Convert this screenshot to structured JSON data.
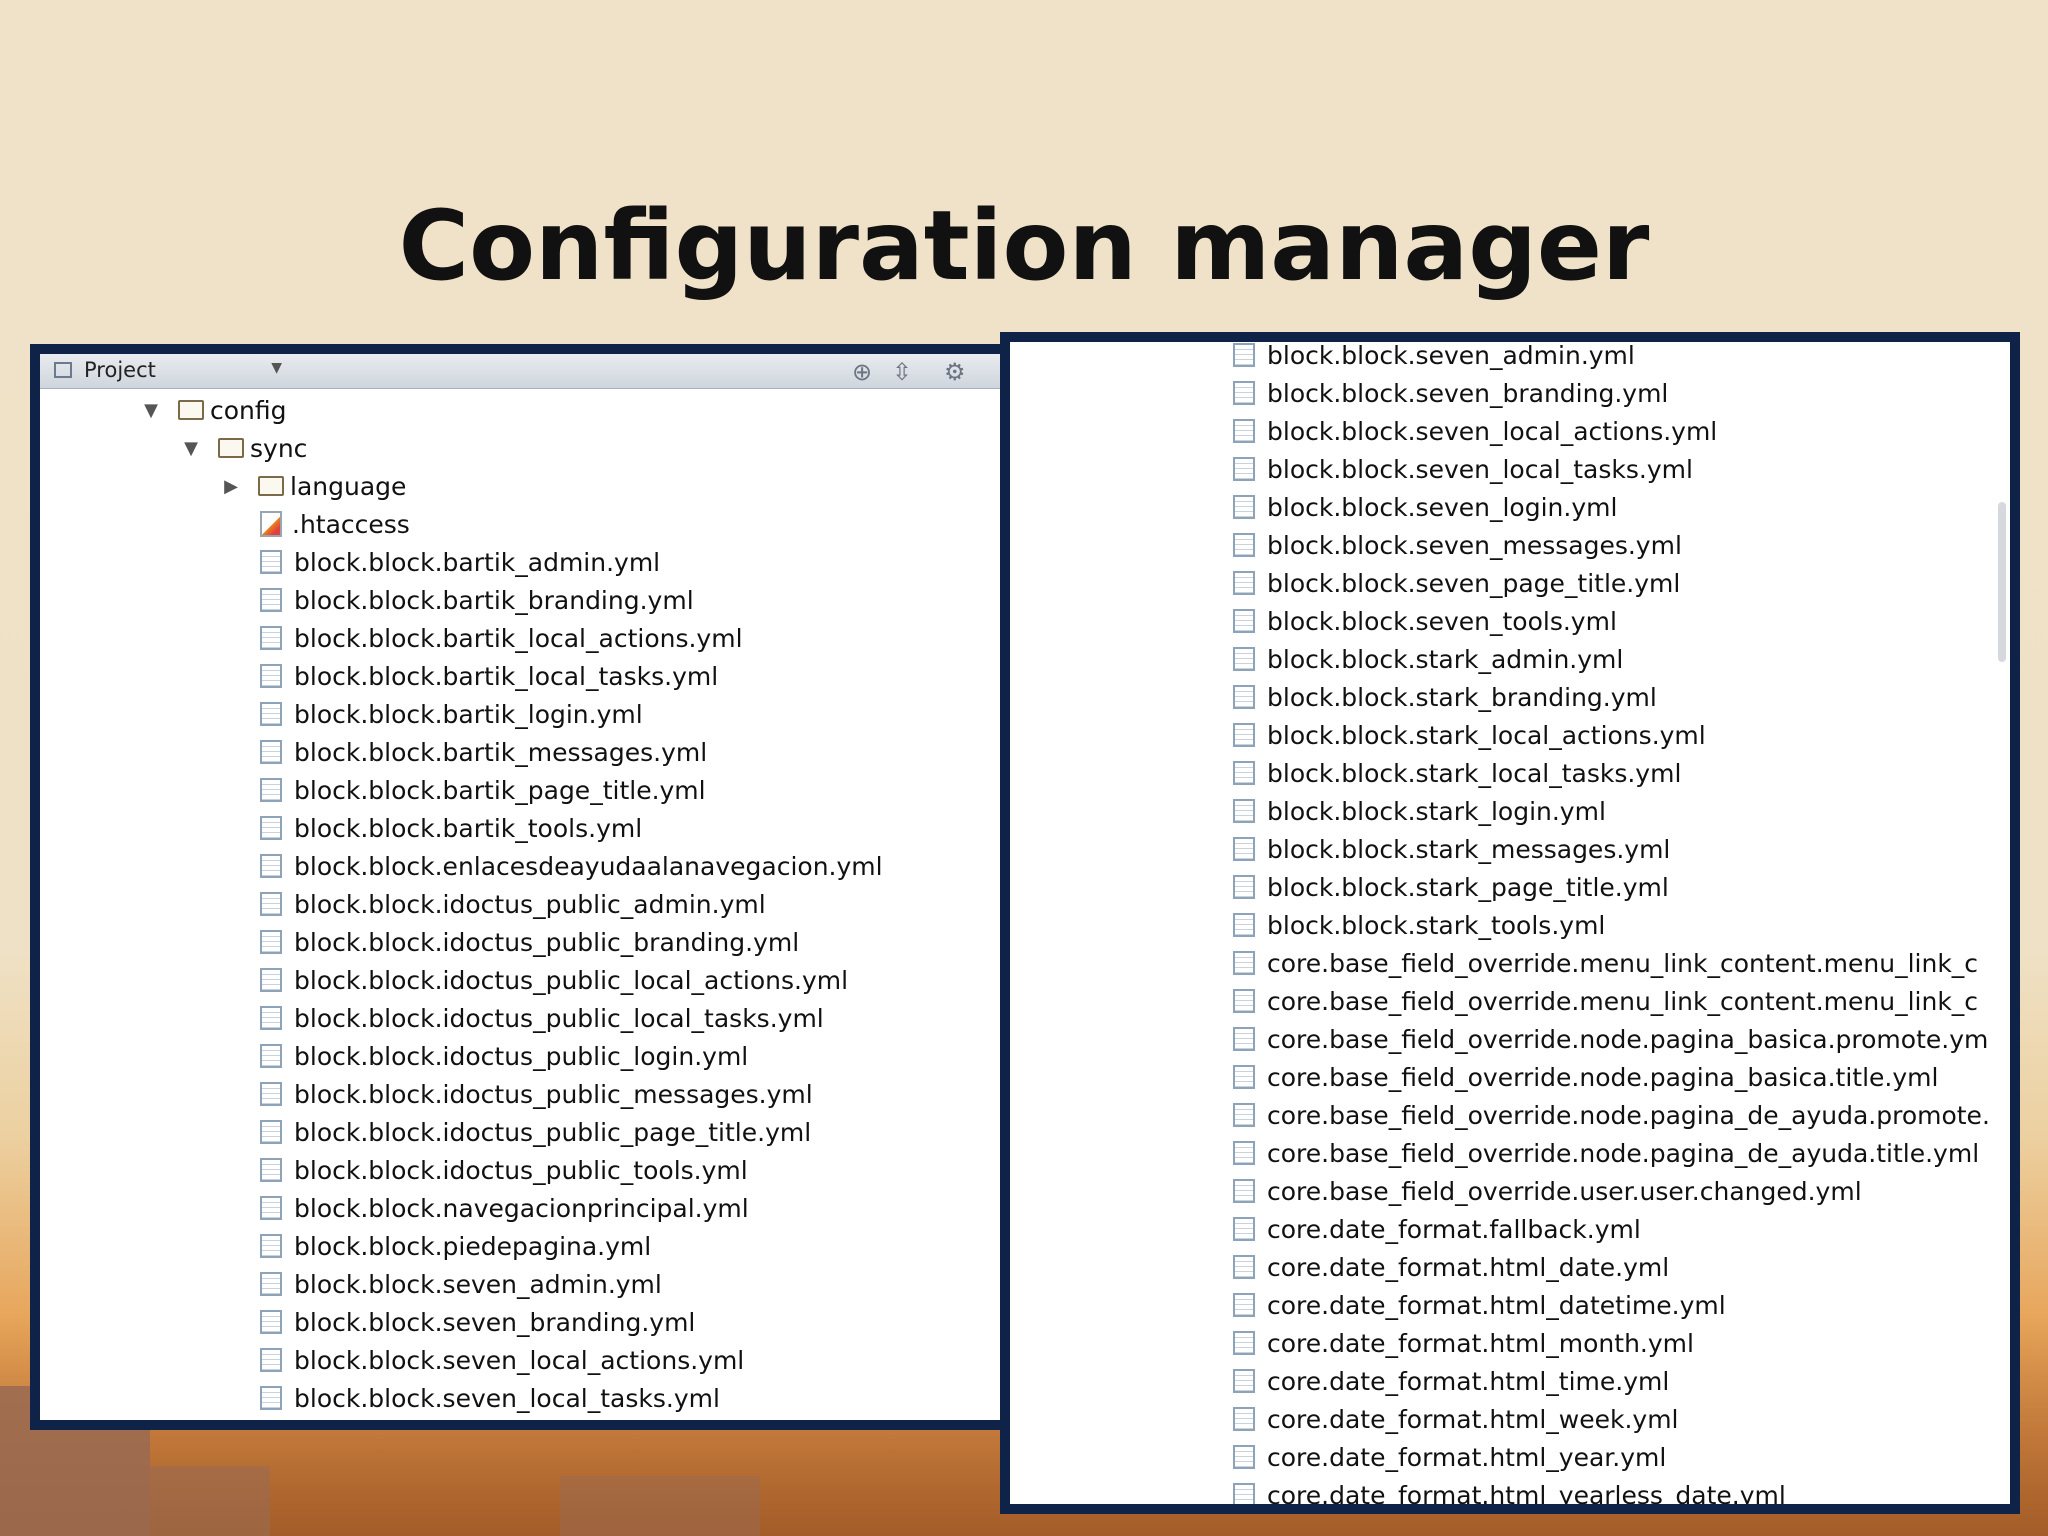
{
  "slide": {
    "title": "Configuration manager"
  },
  "left_panel": {
    "toolbar": {
      "view_label": "Project"
    },
    "tree": [
      {
        "label": "config",
        "type": "folder",
        "level": 0,
        "expanded": true
      },
      {
        "label": "sync",
        "type": "folder",
        "level": 1,
        "expanded": true
      },
      {
        "label": "language",
        "type": "folder",
        "level": 2,
        "expanded": false
      },
      {
        "label": ".htaccess",
        "type": "htaccess",
        "level": 2
      },
      {
        "label": "block.block.bartik_admin.yml",
        "type": "file",
        "level": 2
      },
      {
        "label": "block.block.bartik_branding.yml",
        "type": "file",
        "level": 2
      },
      {
        "label": "block.block.bartik_local_actions.yml",
        "type": "file",
        "level": 2
      },
      {
        "label": "block.block.bartik_local_tasks.yml",
        "type": "file",
        "level": 2
      },
      {
        "label": "block.block.bartik_login.yml",
        "type": "file",
        "level": 2
      },
      {
        "label": "block.block.bartik_messages.yml",
        "type": "file",
        "level": 2
      },
      {
        "label": "block.block.bartik_page_title.yml",
        "type": "file",
        "level": 2
      },
      {
        "label": "block.block.bartik_tools.yml",
        "type": "file",
        "level": 2
      },
      {
        "label": "block.block.enlacesdeayudaalanavegacion.yml",
        "type": "file",
        "level": 2
      },
      {
        "label": "block.block.idoctus_public_admin.yml",
        "type": "file",
        "level": 2
      },
      {
        "label": "block.block.idoctus_public_branding.yml",
        "type": "file",
        "level": 2
      },
      {
        "label": "block.block.idoctus_public_local_actions.yml",
        "type": "file",
        "level": 2
      },
      {
        "label": "block.block.idoctus_public_local_tasks.yml",
        "type": "file",
        "level": 2
      },
      {
        "label": "block.block.idoctus_public_login.yml",
        "type": "file",
        "level": 2
      },
      {
        "label": "block.block.idoctus_public_messages.yml",
        "type": "file",
        "level": 2
      },
      {
        "label": "block.block.idoctus_public_page_title.yml",
        "type": "file",
        "level": 2
      },
      {
        "label": "block.block.idoctus_public_tools.yml",
        "type": "file",
        "level": 2
      },
      {
        "label": "block.block.navegacionprincipal.yml",
        "type": "file",
        "level": 2
      },
      {
        "label": "block.block.piedepagina.yml",
        "type": "file",
        "level": 2
      },
      {
        "label": "block.block.seven_admin.yml",
        "type": "file",
        "level": 2
      },
      {
        "label": "block.block.seven_branding.yml",
        "type": "file",
        "level": 2
      },
      {
        "label": "block.block.seven_local_actions.yml",
        "type": "file",
        "level": 2
      },
      {
        "label": "block.block.seven_local_tasks.yml",
        "type": "file",
        "level": 2
      }
    ]
  },
  "right_panel": {
    "files": [
      "block.block.seven_admin.yml",
      "block.block.seven_branding.yml",
      "block.block.seven_local_actions.yml",
      "block.block.seven_local_tasks.yml",
      "block.block.seven_login.yml",
      "block.block.seven_messages.yml",
      "block.block.seven_page_title.yml",
      "block.block.seven_tools.yml",
      "block.block.stark_admin.yml",
      "block.block.stark_branding.yml",
      "block.block.stark_local_actions.yml",
      "block.block.stark_local_tasks.yml",
      "block.block.stark_login.yml",
      "block.block.stark_messages.yml",
      "block.block.stark_page_title.yml",
      "block.block.stark_tools.yml",
      "core.base_field_override.menu_link_content.menu_link_c",
      "core.base_field_override.menu_link_content.menu_link_c",
      "core.base_field_override.node.pagina_basica.promote.ym",
      "core.base_field_override.node.pagina_basica.title.yml",
      "core.base_field_override.node.pagina_de_ayuda.promote.",
      "core.base_field_override.node.pagina_de_ayuda.title.yml",
      "core.base_field_override.user.user.changed.yml",
      "core.date_format.fallback.yml",
      "core.date_format.html_date.yml",
      "core.date_format.html_datetime.yml",
      "core.date_format.html_month.yml",
      "core.date_format.html_time.yml",
      "core.date_format.html_week.yml",
      "core.date_format.html_year.yml",
      "core.date_format.html_yearless_date.yml"
    ]
  },
  "icons": {
    "toolbar": [
      "target-icon",
      "collapse-icon",
      "gear-icon"
    ]
  }
}
